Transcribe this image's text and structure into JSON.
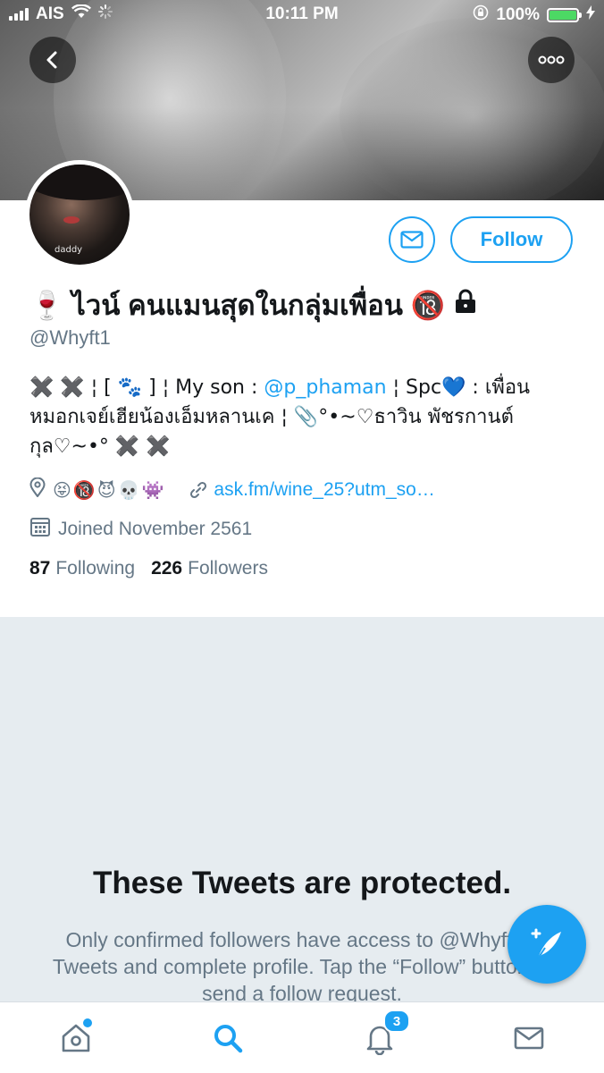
{
  "status_bar": {
    "carrier": "AIS",
    "time": "10:11 PM",
    "battery_percent": "100%",
    "battery_level": 1.0
  },
  "header": {
    "back_icon": "chevron-left-icon",
    "more_icon": "more-horizontal-icon"
  },
  "avatar": {
    "caption": "daddy"
  },
  "profile": {
    "follow_label": "Follow",
    "message_icon": "envelope-icon",
    "display_name": "🍷 ไวน์ คนแมนสุดในกลุ่มเพื่อน 🔞",
    "lock_icon": "lock-icon",
    "handle": "@Whyft1",
    "bio": {
      "part1": "✖️ ✖️ ¦ [ 🐾 ] ¦ My son : ",
      "mention": "@p_phaman",
      "part2": " ¦ Spc💙 : เพื่อนหมอกเจย์เฮียน้องเอ็มหลานเค ¦ 📎°•~♡ธาวิน พัชรกานต์กุล♡~•° ✖️ ✖️"
    },
    "location": "😝🔞😈💀👾",
    "url": "ask.fm/wine_25?utm_so…",
    "joined": "Joined November 2561",
    "following_count": "87",
    "following_label": "Following",
    "followers_count": "226",
    "followers_label": "Followers"
  },
  "protected": {
    "title": "These Tweets are protected.",
    "body": "Only confirmed followers have access to @Whyft1’s Tweets and complete profile. Tap the “Follow” button to send a follow request."
  },
  "tabbar": {
    "notifications_badge": "3",
    "icons": [
      "home-icon",
      "search-icon",
      "bell-icon",
      "mail-icon"
    ]
  },
  "colors": {
    "accent": "#1da1f2",
    "background": "#e6ecf0",
    "secondary_text": "#657786"
  }
}
